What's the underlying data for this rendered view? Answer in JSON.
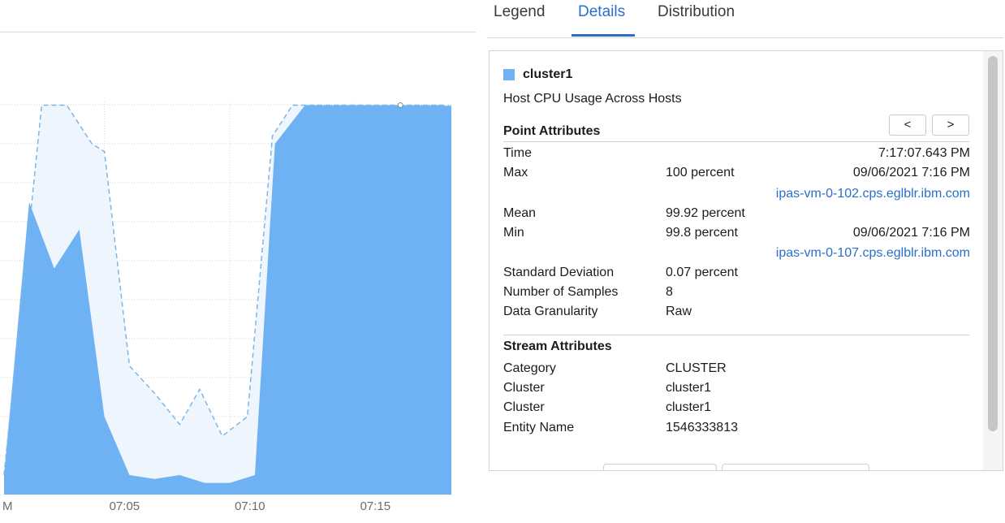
{
  "chart_data": {
    "type": "area",
    "x_tick_labels": [
      "M",
      "07:05",
      "07:10",
      "07:15"
    ],
    "x_ticks_min": [
      0,
      4,
      9,
      14
    ],
    "series": [
      {
        "role": "range-max",
        "style": "dashed",
        "x": [
          0,
          1.5,
          2.5,
          3.5,
          4,
          5,
          6,
          7,
          7.8,
          8.7,
          9.7,
          10.7,
          11.5,
          15.5,
          17.5,
          18
        ],
        "y": [
          5,
          99.9,
          99.9,
          90,
          88,
          33,
          26,
          18,
          27,
          15,
          20,
          92,
          99.9,
          99.9,
          99.9,
          99.6
        ]
      },
      {
        "role": "mean",
        "style": "filled",
        "x": [
          0,
          1,
          2,
          3,
          4,
          5,
          6,
          7,
          8,
          9,
          10,
          10.8,
          12,
          15.5,
          17.5,
          18
        ],
        "y": [
          5,
          75,
          58,
          68,
          20,
          5,
          4,
          5,
          3,
          3,
          5,
          90,
          99.9,
          99.9,
          99.9,
          99.4
        ]
      }
    ],
    "ylim": [
      0,
      100
    ],
    "grid": true
  },
  "tabs": [
    {
      "label": "Legend",
      "active": false
    },
    {
      "label": "Details",
      "active": true
    },
    {
      "label": "Distribution",
      "active": false
    }
  ],
  "details": {
    "series_name": "cluster1",
    "series_color": "#6fb2f3",
    "metric_title": "Host CPU Usage Across Hosts",
    "point_section": "Point Attributes",
    "prev_label": "<",
    "next_label": ">",
    "time_label": "Time",
    "time_value": "7:17:07.643 PM",
    "max_label": "Max",
    "max_value": "100 percent",
    "max_time": "09/06/2021 7:16 PM",
    "max_host": "ipas-vm-0-102.cps.eglblr.ibm.com",
    "mean_label": "Mean",
    "mean_value": "99.92 percent",
    "min_label": "Min",
    "min_value": "99.8 percent",
    "min_time": "09/06/2021 7:16 PM",
    "min_host": "ipas-vm-0-107.cps.eglblr.ibm.com",
    "stddev_label": "Standard Deviation",
    "stddev_value": "0.07 percent",
    "samples_label": "Number of Samples",
    "samples_value": "8",
    "granularity_label": "Data Granularity",
    "granularity_value": "Raw",
    "stream_section": "Stream Attributes",
    "category_label": "Category",
    "category_value": "CLUSTER",
    "cluster_label_1": "Cluster",
    "cluster_value_1": "cluster1",
    "cluster_label_2": "Cluster",
    "cluster_value_2": "cluster1",
    "entity_label": "Entity Name",
    "entity_value": "1546333813"
  },
  "colors": {
    "area_fill": "#6fb2f3",
    "range_fill": "#eef5fd",
    "dashed_line": "#7bb6ea",
    "accent": "#2a6fca"
  }
}
